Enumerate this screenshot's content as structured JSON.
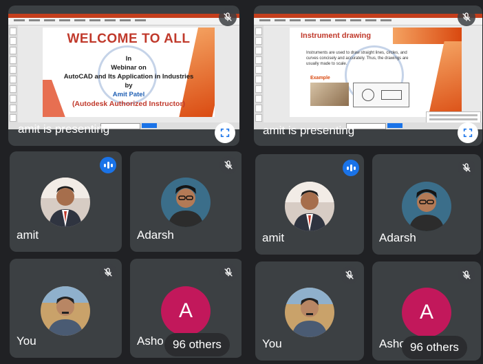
{
  "left_view": {
    "presentation": {
      "slide": {
        "title": "WELCOME TO ALL",
        "line1": "In",
        "line2": "Webinar on",
        "line3": "AutoCAD and Its Application in Industries",
        "line4": "by",
        "line5": "Amit Patel",
        "line6": "(Autodesk Authorized Instructor)"
      },
      "presenting_label": "amit is presenting"
    },
    "tiles": [
      {
        "name": "amit",
        "speaking": true
      },
      {
        "name": "Adarsh",
        "muted": true
      },
      {
        "name": "You",
        "muted": true
      },
      {
        "name": "Asho",
        "avatar_letter": "A",
        "muted": true,
        "others_label": "96 others"
      }
    ]
  },
  "right_view": {
    "presentation": {
      "slide": {
        "title": "Instrument drawing",
        "body": "Instruments are used to draw straight lines, circles, and curves concisely and accurately. Thus, the drawings are usually made to scale.",
        "example_label": "Example"
      },
      "presenting_label": "amit is presenting"
    },
    "tiles": [
      {
        "name": "amit",
        "speaking": true
      },
      {
        "name": "Adarsh",
        "muted": true
      },
      {
        "name": "You",
        "muted": true
      },
      {
        "name": "Asho",
        "avatar_letter": "A",
        "muted": true,
        "others_label": "96 others"
      }
    ]
  },
  "colors": {
    "background": "#202124",
    "tile": "#3c4043",
    "speaking": "#1a73e8",
    "letter_avatar": "#c2185b"
  },
  "icons": {
    "mute": "mic-off-icon",
    "speaking": "audio-level-icon",
    "fullscreen": "fullscreen-icon"
  }
}
